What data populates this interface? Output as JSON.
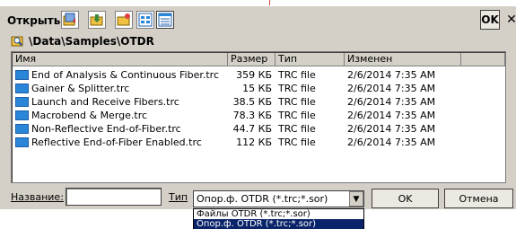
{
  "header": {
    "title": "Открыть",
    "ok_label": "OK",
    "close_label": "✕"
  },
  "path": {
    "text": "\\Data\\Samples\\OTDR"
  },
  "columns": {
    "name": "Имя",
    "size": "Размер",
    "type": "Тип",
    "modified": "Изменен"
  },
  "files": [
    {
      "name": "End of Analysis & Continuous Fiber.trc",
      "size": "359 КБ",
      "type": "TRC file",
      "modified": "2/6/2014 7:35 AM"
    },
    {
      "name": "Gainer & Splitter.trc",
      "size": "15 КБ",
      "type": "TRC file",
      "modified": "2/6/2014 7:35 AM"
    },
    {
      "name": "Launch and Receive Fibers.trc",
      "size": "38.5 КБ",
      "type": "TRC file",
      "modified": "2/6/2014 7:35 AM"
    },
    {
      "name": "Macrobend & Merge.trc",
      "size": "78.3 КБ",
      "type": "TRC file",
      "modified": "2/6/2014 7:35 AM"
    },
    {
      "name": "Non-Reflective End-of-Fiber.trc",
      "size": "44.7 КБ",
      "type": "TRC file",
      "modified": "2/6/2014 7:35 AM"
    },
    {
      "name": "Reflective End-of-Fiber Enabled.trc",
      "size": "112 КБ",
      "type": "TRC file",
      "modified": "2/6/2014 7:35 AM"
    }
  ],
  "footer": {
    "name_label": "Название:",
    "name_value": "",
    "type_label": "Тип",
    "type_value": "Опор.ф. OTDR (*.trc;*.sor)",
    "ok_label": "OK",
    "cancel_label": "Отмена"
  },
  "dropdown": {
    "options": [
      "Файлы OTDR (*.trc;*.sor)",
      "Опор.ф. OTDR (*.trc;*.sor)"
    ],
    "selected_index": 1
  },
  "colors": {
    "selection": "#0a246a",
    "file_icon": "#2a86d8",
    "dialog_bg": "#d4d0c8"
  }
}
